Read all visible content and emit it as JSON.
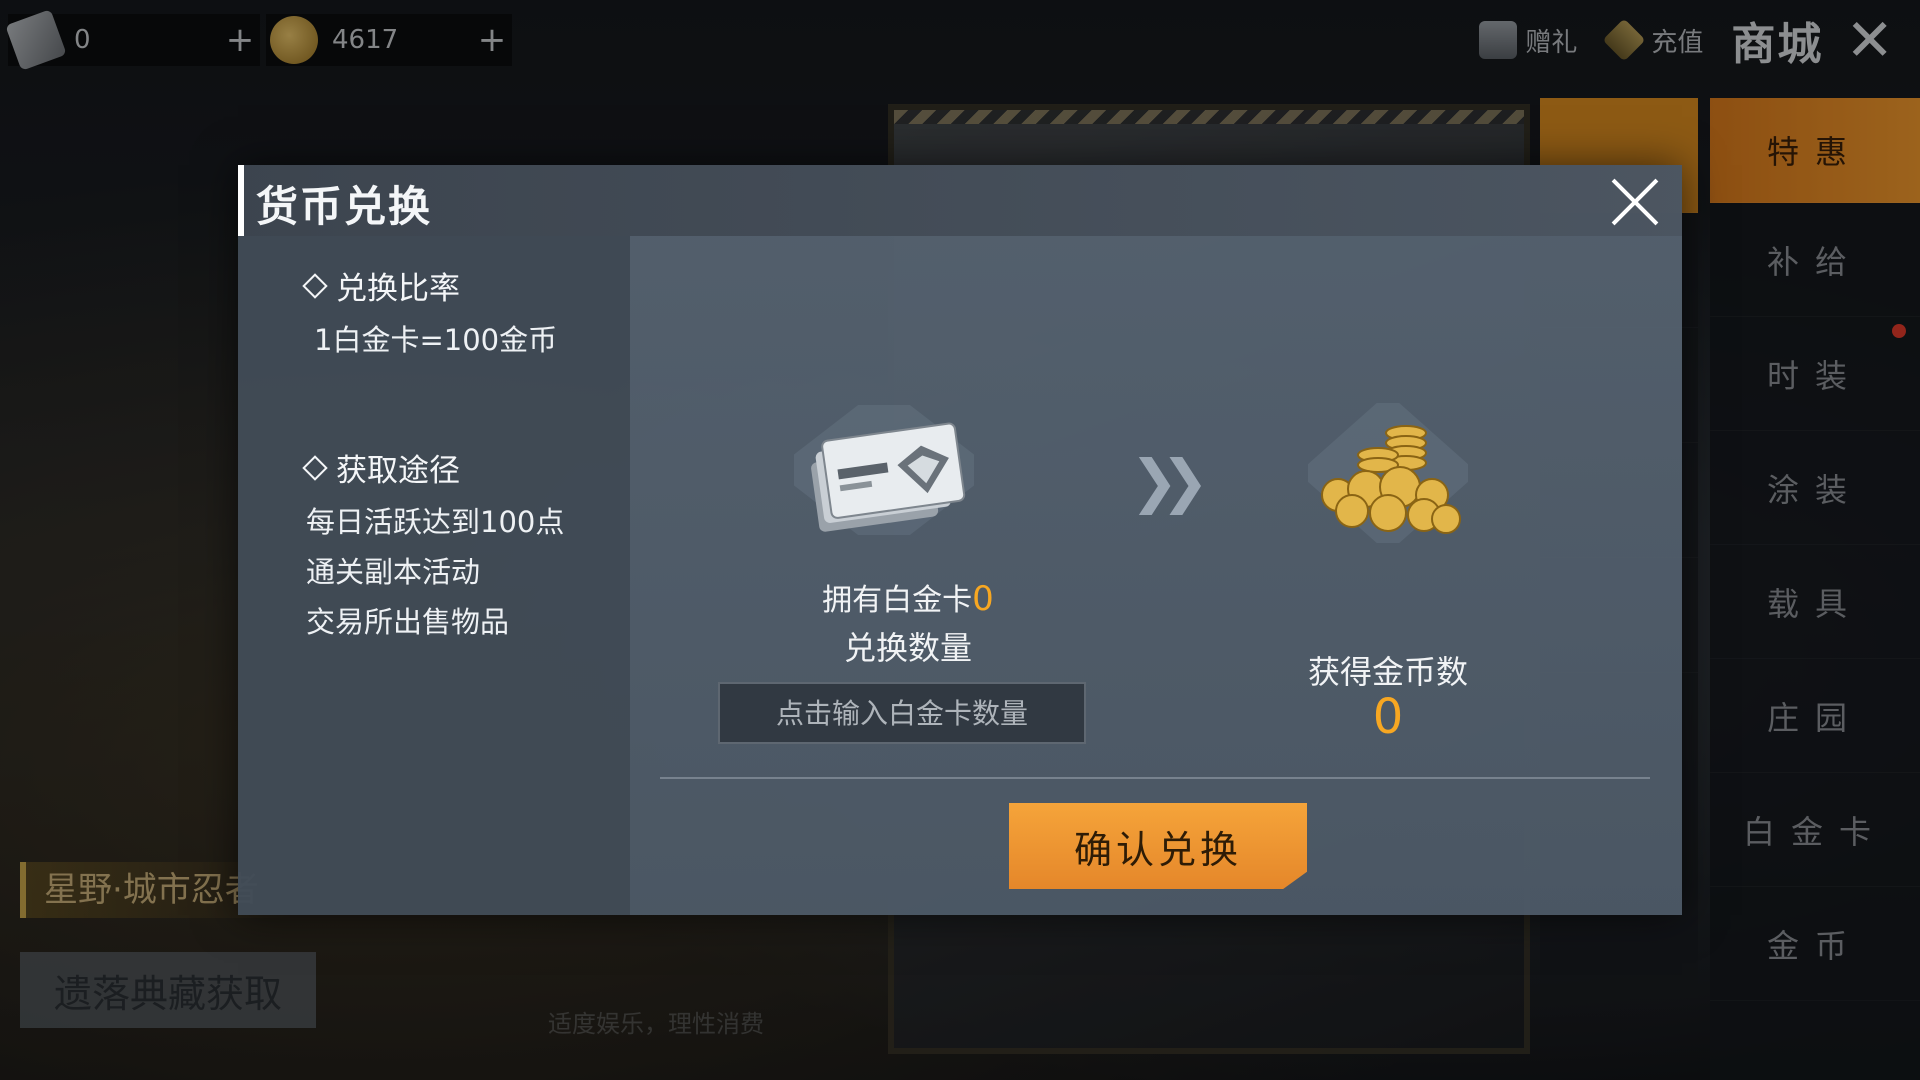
{
  "topbar": {
    "card_count": "0",
    "coin_count": "4617",
    "plus": "+",
    "gift_label": "赠礼",
    "recharge_label": "充值",
    "shop_title": "商城"
  },
  "side_menu": {
    "items": [
      {
        "label": "特惠"
      },
      {
        "label": "补给"
      },
      {
        "label": "时装"
      },
      {
        "label": "涂装"
      },
      {
        "label": "载具"
      },
      {
        "label": "庄园"
      },
      {
        "label": "白金卡"
      },
      {
        "label": "金币"
      }
    ],
    "active_index": 0
  },
  "background": {
    "collection_title": "星野·城市忍者",
    "lost_collection_button": "遗落典藏获取",
    "footer_note": "适度娱乐，理性消费"
  },
  "dialog": {
    "title": "货币兑换",
    "rate_heading": "兑换比率",
    "rate_text": "1白金卡=100金币",
    "source_heading": "获取途径",
    "sources": [
      "每日活跃达到100点",
      "通关副本活动",
      "交易所出售物品"
    ],
    "own_label": "拥有白金卡",
    "own_value": "0",
    "exchange_label": "兑换数量",
    "exchange_placeholder": "点击输入白金卡数量",
    "get_label": "获得金币数",
    "get_value": "0",
    "confirm_label": "确认兑换"
  },
  "colors": {
    "accent": "#f7a722",
    "confirm_button": "#f09a30",
    "dialog_bg": "#46505c"
  }
}
